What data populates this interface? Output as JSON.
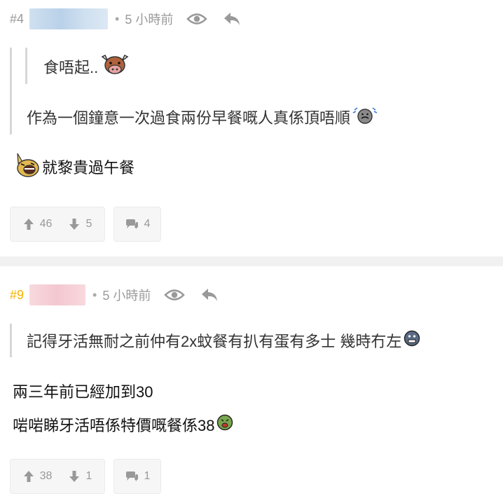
{
  "posts": [
    {
      "number": "#4",
      "time": "5 小時前",
      "quote_nested": "食唔起..",
      "quote": "作為一個鐘意一次過食兩份早餐嘅人真係頂唔順",
      "body_lines": [
        "就黎貴過午餐"
      ],
      "upvotes": "46",
      "downvotes": "5",
      "replies": "4",
      "number_color": "#9a9a9a"
    },
    {
      "number": "#9",
      "time": "5 小時前",
      "quote": "記得牙活無耐之前仲有2x蚊餐有扒有蛋有多士 幾時冇左",
      "body_lines": [
        "兩三年前已經加到30",
        "啱啱睇牙活唔係特價嘅餐係38"
      ],
      "upvotes": "38",
      "downvotes": "1",
      "replies": "1",
      "number_color": "#f5b400"
    }
  ],
  "icons": {
    "view": "eye-icon",
    "reply": "reply-arrow-icon",
    "upvote": "thumb-up-arrow-icon",
    "downvote": "thumb-down-arrow-icon",
    "comment": "comment-bubble-icon"
  }
}
